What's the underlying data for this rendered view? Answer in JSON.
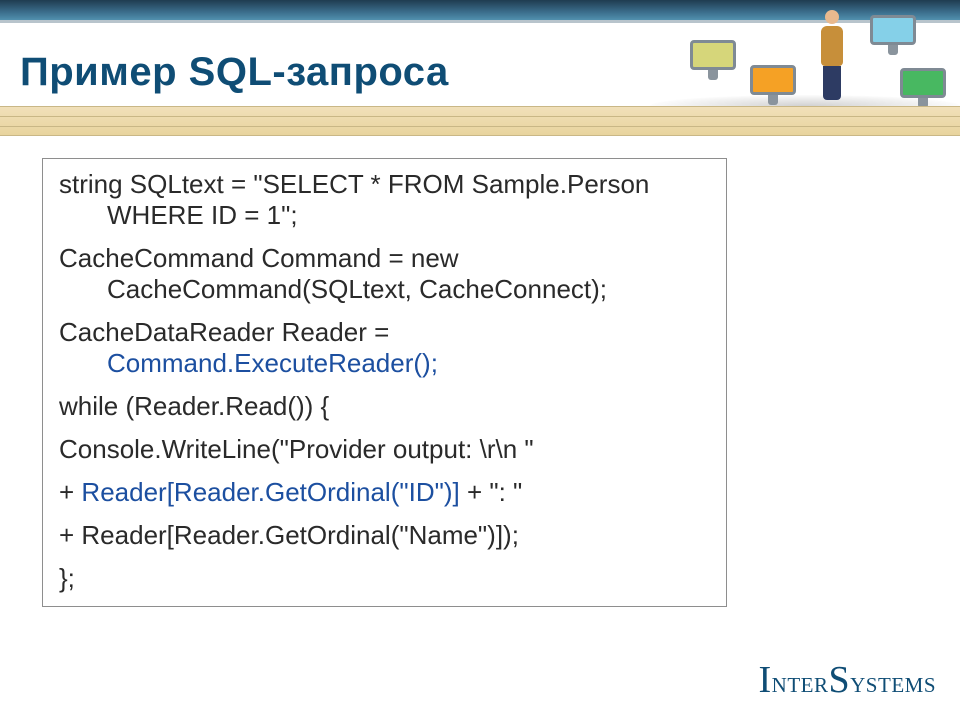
{
  "slide": {
    "title": "Пример SQL-запроса"
  },
  "code": {
    "s1a": "string SQLtext = \"SELECT * FROM Sample.Person",
    "s1b": "WHERE ID = 1\";",
    "s2a": "CacheCommand Command = new",
    "s2b": "CacheCommand(SQLtext, CacheConnect);",
    "s3a": "CacheDataReader Reader = ",
    "s3b": "Command.ExecuteReader();",
    "s4": "while (Reader.Read()) {",
    "s5": "Console.WriteLine(\"Provider output: \\r\\n \"",
    "s6a": "+ ",
    "s6b": "Reader[Reader.GetOrdinal(\"ID\")]",
    "s6c": " + \": \"",
    "s7": "+ Reader[Reader.GetOrdinal(\"Name\")]);",
    "s8": "};"
  },
  "branding": {
    "logo_prefix": "I",
    "logo_mid": "nter",
    "logo_prefix2": "S",
    "logo_rest": "ystems"
  }
}
